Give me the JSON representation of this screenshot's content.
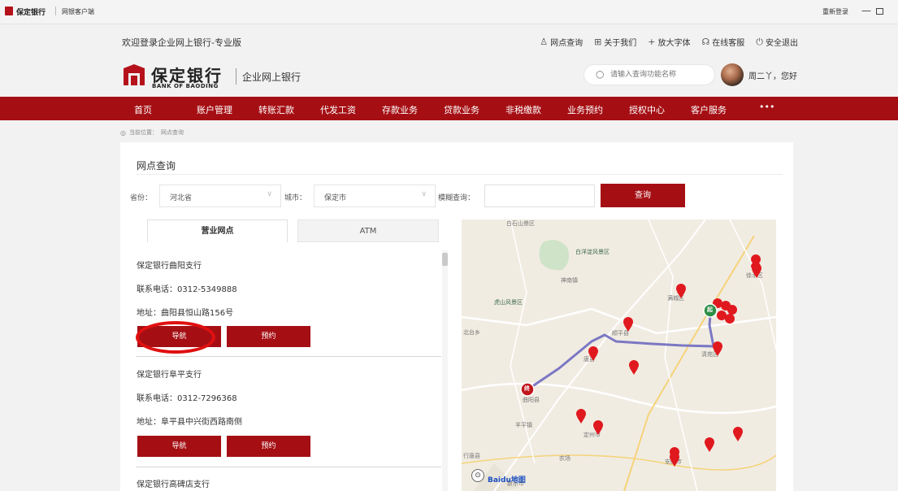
{
  "titlebar": {
    "brand": "保定银行",
    "title": "网银客户端",
    "relogin": "重新登录",
    "minimize": "—"
  },
  "header": {
    "welcome": "欢迎登录企业网上银行-专业版",
    "links": [
      {
        "icon": "location-person-icon",
        "glyph": "♙",
        "label": "网点查询"
      },
      {
        "icon": "grid-icon",
        "glyph": "⊞",
        "label": "关于我们"
      },
      {
        "icon": "plus-icon",
        "glyph": "+",
        "label": "放大字体"
      },
      {
        "icon": "headset-icon",
        "glyph": "☊",
        "label": "在线客服"
      },
      {
        "icon": "power-icon",
        "glyph": "⏻",
        "label": "安全退出"
      }
    ]
  },
  "brand": {
    "name": "保定银行",
    "name_en": "BANK OF BAODING",
    "subtitle": "企业网上银行",
    "search_placeholder": "请输入查询功能名称",
    "greeting": "周二丫，您好"
  },
  "nav": {
    "items": [
      "首页",
      "账户管理",
      "转账汇款",
      "代发工资",
      "存款业务",
      "贷款业务",
      "非税缴款",
      "业务预约",
      "授权中心",
      "客户服务",
      "•••"
    ]
  },
  "breadcrumb": {
    "prefix": "当前位置：",
    "current": "网点查询"
  },
  "page": {
    "title": "网点查询",
    "filters": {
      "province_label": "省份：",
      "province_value": "河北省",
      "city_label": "城市：",
      "city_value": "保定市",
      "fuzzy_label": "模糊查询：",
      "fuzzy_value": "",
      "query_button": "查询"
    },
    "tabs": [
      {
        "label": "营业网点",
        "active": true
      },
      {
        "label": "ATM",
        "active": false
      }
    ],
    "branches": [
      {
        "name": "保定银行曲阳支行",
        "phone": "联系电话：0312-5349888",
        "address": "地址：曲阳县恒山路156号",
        "nav": "导航",
        "reserve": "预约"
      },
      {
        "name": "保定银行阜平支行",
        "phone": "联系电话：0312-7296368",
        "address": "地址：阜平县中兴街西路南侧",
        "nav": "导航",
        "reserve": "预约"
      },
      {
        "name": "保定银行高碑店支行",
        "phone": "",
        "address": "",
        "nav": "",
        "reserve": ""
      }
    ]
  },
  "map": {
    "labels": [
      "白石山景区",
      "白洋淀风景区",
      "虎山风景区",
      "神南镇",
      "北台乡",
      "满城区",
      "顺平县",
      "唐县",
      "徐水区",
      "清苑区",
      "曲阳县",
      "羊平镇",
      "定州市",
      "行唐县",
      "农场",
      "安国市",
      "新乐市"
    ],
    "start_marker": "起",
    "end_marker": "终",
    "route_color": "#7b78c4",
    "pin_color": "#e0191e",
    "logo": "Baidu地图"
  },
  "colors": {
    "brand_red": "#a50f14",
    "annotation_red": "#e01010"
  }
}
